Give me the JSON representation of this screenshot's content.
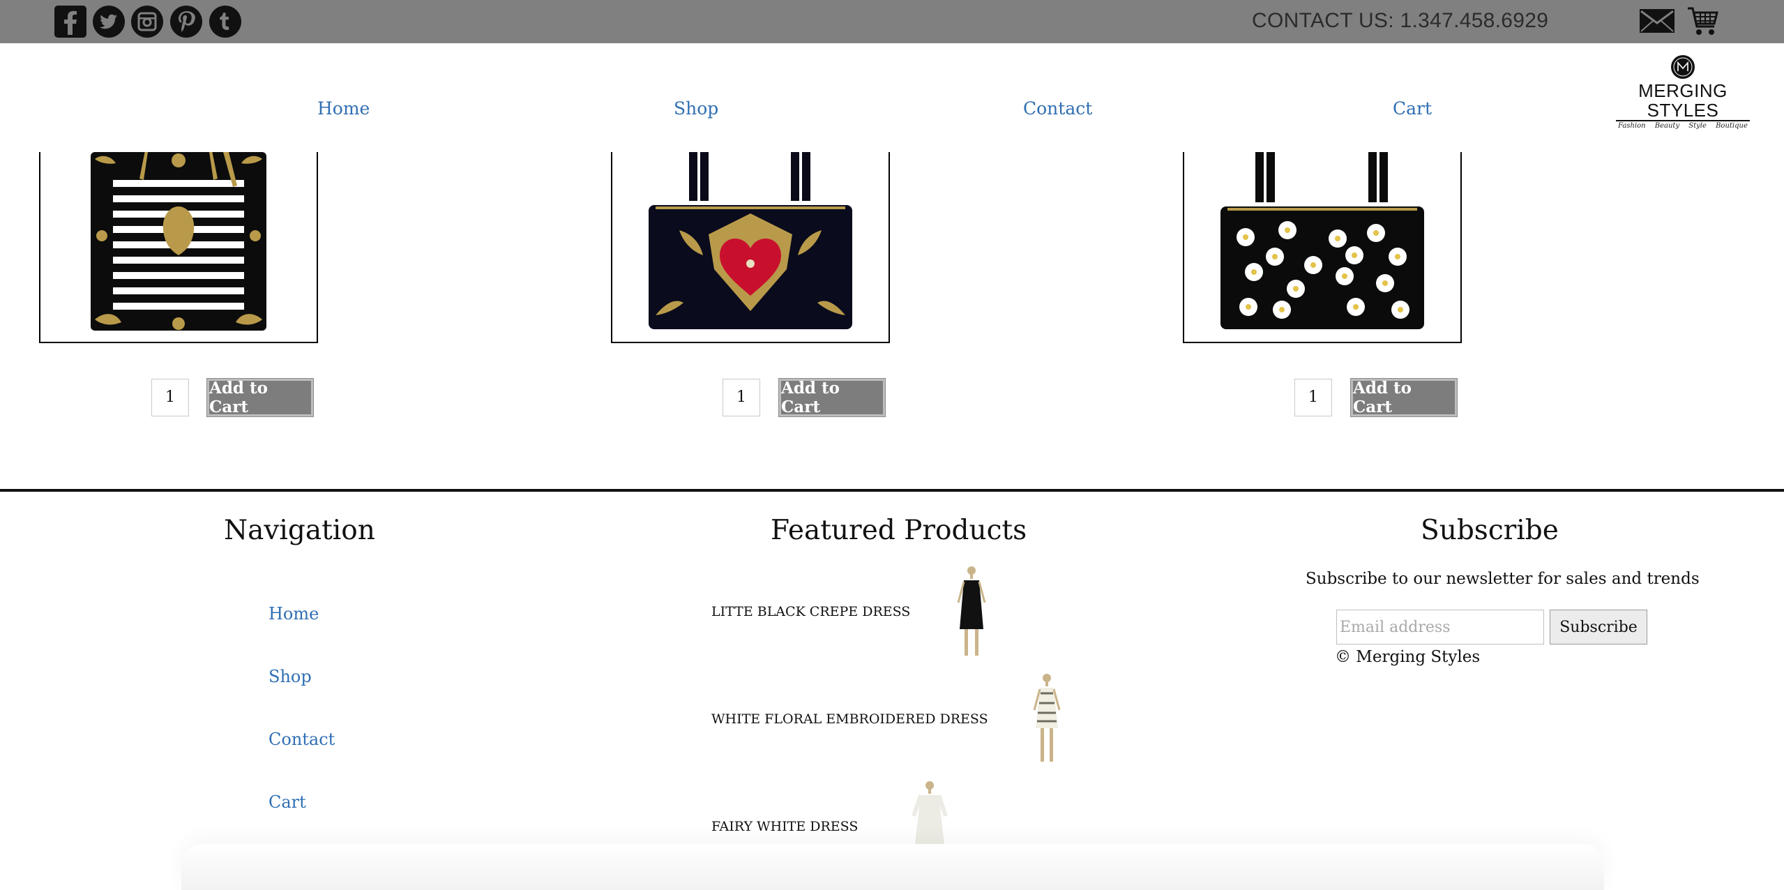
{
  "topbar": {
    "social_icons": [
      "facebook-icon",
      "twitter-icon",
      "instagram-icon",
      "pinterest-icon",
      "tumblr-icon"
    ],
    "contact_text": "CONTACT US: 1.347.458.6929",
    "mail_icon": "mail-icon",
    "cart_icon": "shopping-cart-icon",
    "bg_color": "#808080"
  },
  "nav": {
    "items": [
      {
        "label": "Home"
      },
      {
        "label": "Shop"
      },
      {
        "label": "Contact"
      },
      {
        "label": "Cart"
      }
    ],
    "link_color": "#2f6fb3"
  },
  "logo": {
    "name": "MERGING STYLES",
    "tagline": "Fashion Beauty Style Boutique"
  },
  "products": [
    {
      "image": "black-white-striped-handbag-gold-embellished",
      "quantity": "1",
      "button": "Add to Cart"
    },
    {
      "image": "black-handbag-red-heart-embroidery",
      "quantity": "1",
      "button": "Add to Cart"
    },
    {
      "image": "black-handbag-white-daisies",
      "quantity": "1",
      "button": "Add to Cart"
    }
  ],
  "footer": {
    "navigation": {
      "title": "Navigation",
      "links": [
        "Home",
        "Shop",
        "Contact",
        "Cart"
      ]
    },
    "featured": {
      "title": "Featured Products",
      "items": [
        {
          "name": "LITTE BLACK CREPE DRESS",
          "image": "black-dress-mannequin"
        },
        {
          "name": "WHITE FLORAL EMBROIDERED DRESS",
          "image": "white-floral-dress-mannequin"
        },
        {
          "name": "FAIRY WHITE DRESS",
          "image": "white-lace-dress-mannequin"
        }
      ]
    },
    "subscribe": {
      "title": "Subscribe",
      "text": "Subscribe to our newsletter for sales and trends",
      "email_placeholder": "Email address",
      "button": "Subscribe",
      "copyright": "© Merging Styles"
    }
  }
}
